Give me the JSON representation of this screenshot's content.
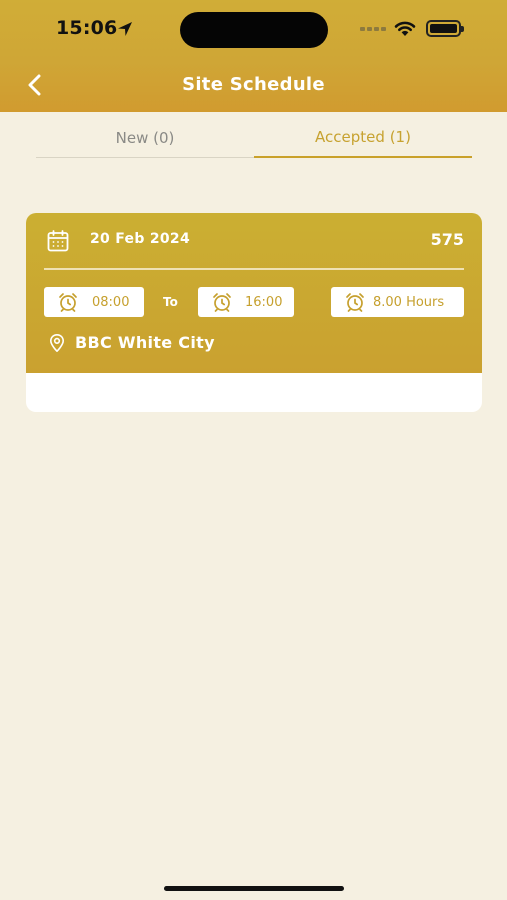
{
  "status_bar": {
    "time": "15:06"
  },
  "header": {
    "title": "Site Schedule",
    "back_icon": "chevron-left-icon"
  },
  "tabs": [
    {
      "label": "New (0)",
      "active": false
    },
    {
      "label": "Accepted (1)",
      "active": true
    }
  ],
  "colors": {
    "brand_gold": "#cba630",
    "background": "#f5f0e1",
    "tab_active": "#c9a12a",
    "tab_inactive": "#8a8a86"
  },
  "schedule_card": {
    "date": "20 Feb 2024",
    "job_number": "575",
    "start_time": "08:00",
    "to_label": "To",
    "end_time": "16:00",
    "duration": "8.00 Hours",
    "location": "BBC White City"
  }
}
